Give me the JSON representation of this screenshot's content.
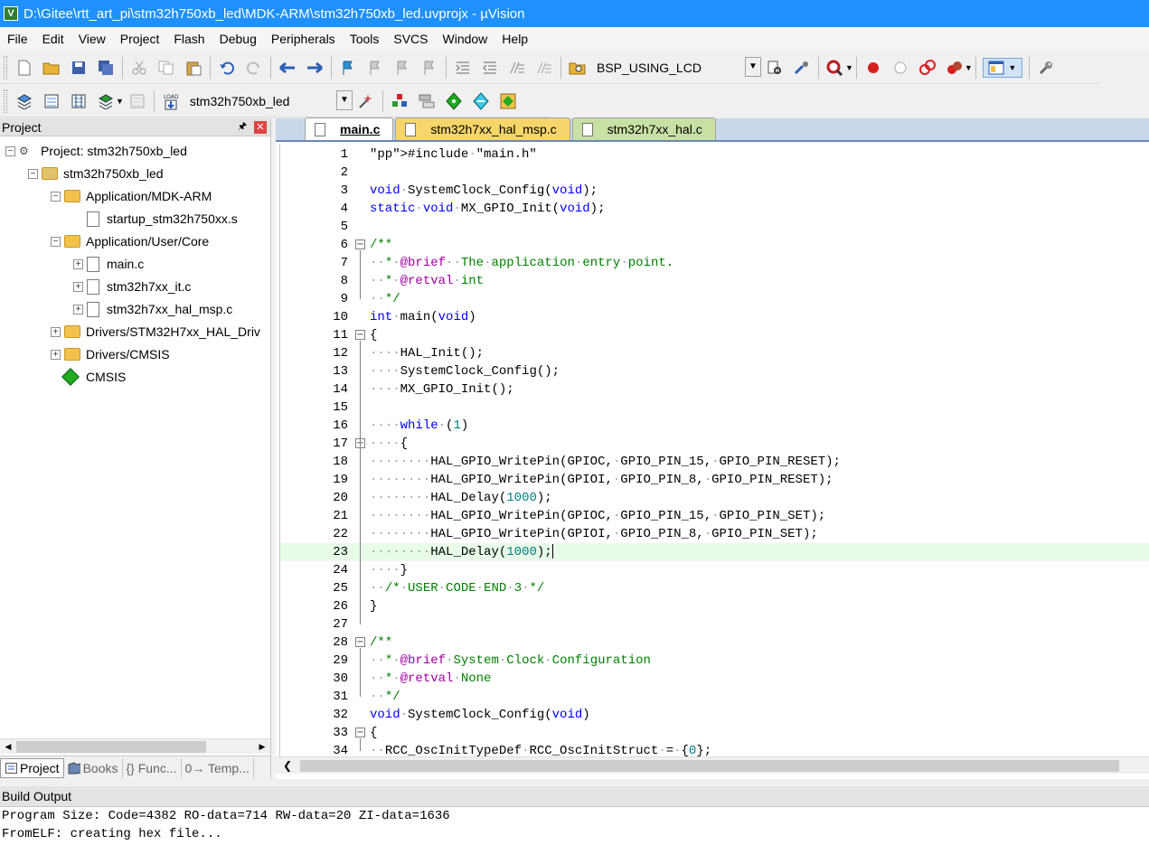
{
  "window": {
    "title": "D:\\Gitee\\rtt_art_pi\\stm32h750xb_led\\MDK-ARM\\stm32h750xb_led.uvprojx - µVision",
    "app_icon_letter": "V"
  },
  "menu": [
    "File",
    "Edit",
    "View",
    "Project",
    "Flash",
    "Debug",
    "Peripherals",
    "Tools",
    "SVCS",
    "Window",
    "Help"
  ],
  "toolbar": {
    "find_combo_value": "BSP_USING_LCD",
    "target_combo_value": "stm32h750xb_led"
  },
  "project_panel": {
    "title": "Project",
    "pin_glyph": "ᵖ",
    "close_glyph": "x",
    "tree": [
      {
        "label": "Project: stm32h750xb_led",
        "level": 0,
        "type": "project",
        "expander": "−"
      },
      {
        "label": "stm32h750xb_led",
        "level": 1,
        "type": "target",
        "expander": "−"
      },
      {
        "label": "Application/MDK-ARM",
        "level": 2,
        "type": "folder",
        "expander": "−"
      },
      {
        "label": "startup_stm32h750xx.s",
        "level": 3,
        "type": "file",
        "expander": ""
      },
      {
        "label": "Application/User/Core",
        "level": 2,
        "type": "folder",
        "expander": "−"
      },
      {
        "label": "main.c",
        "level": 3,
        "type": "file",
        "expander": "+"
      },
      {
        "label": "stm32h7xx_it.c",
        "level": 3,
        "type": "file",
        "expander": "+"
      },
      {
        "label": "stm32h7xx_hal_msp.c",
        "level": 3,
        "type": "file",
        "expander": "+"
      },
      {
        "label": "Drivers/STM32H7xx_HAL_Driv",
        "level": 2,
        "type": "folder",
        "expander": "+"
      },
      {
        "label": "Drivers/CMSIS",
        "level": 2,
        "type": "folder",
        "expander": "+"
      },
      {
        "label": "CMSIS",
        "level": 2,
        "type": "cmsis",
        "expander": ""
      }
    ],
    "tabs": [
      "Project",
      "Books",
      "{} Func...",
      "0→ Temp..."
    ]
  },
  "editor": {
    "tabs": [
      {
        "label": "main.c",
        "active": true
      },
      {
        "label": "stm32h7xx_hal_msp.c",
        "active": false
      },
      {
        "label": "stm32h7xx_hal.c",
        "active": false
      }
    ],
    "current_line": 23,
    "lines": [
      {
        "n": "1",
        "text": "#include·\"main.h\""
      },
      {
        "n": "2",
        "text": ""
      },
      {
        "n": "3",
        "text": "void·SystemClock_Config(void);"
      },
      {
        "n": "4",
        "text": "static·void·MX_GPIO_Init(void);"
      },
      {
        "n": "5",
        "text": ""
      },
      {
        "n": "6",
        "text": "/**",
        "fold": "−"
      },
      {
        "n": "7",
        "text": "··*·@brief··The·application·entry·point."
      },
      {
        "n": "8",
        "text": "··*·@retval·int"
      },
      {
        "n": "9",
        "text": "··*/"
      },
      {
        "n": "10",
        "text": "int·main(void)"
      },
      {
        "n": "11",
        "text": "{",
        "fold": "−"
      },
      {
        "n": "12",
        "text": "····HAL_Init();"
      },
      {
        "n": "13",
        "text": "····SystemClock_Config();"
      },
      {
        "n": "14",
        "text": "····MX_GPIO_Init();"
      },
      {
        "n": "15",
        "text": ""
      },
      {
        "n": "16",
        "text": "····while·(1)"
      },
      {
        "n": "17",
        "text": "····{",
        "fold": "−"
      },
      {
        "n": "18",
        "text": "········HAL_GPIO_WritePin(GPIOC,·GPIO_PIN_15,·GPIO_PIN_RESET);"
      },
      {
        "n": "19",
        "text": "········HAL_GPIO_WritePin(GPIOI,·GPIO_PIN_8,·GPIO_PIN_RESET);"
      },
      {
        "n": "20",
        "text": "········HAL_Delay(1000);"
      },
      {
        "n": "21",
        "text": "········HAL_GPIO_WritePin(GPIOC,·GPIO_PIN_15,·GPIO_PIN_SET);"
      },
      {
        "n": "22",
        "text": "········HAL_GPIO_WritePin(GPIOI,·GPIO_PIN_8,·GPIO_PIN_SET);"
      },
      {
        "n": "23",
        "text": "········HAL_Delay(1000);"
      },
      {
        "n": "24",
        "text": "····}"
      },
      {
        "n": "25",
        "text": "··/*·USER·CODE·END·3·*/"
      },
      {
        "n": "26",
        "text": "}"
      },
      {
        "n": "27",
        "text": ""
      },
      {
        "n": "28",
        "text": "/**",
        "fold": "−"
      },
      {
        "n": "29",
        "text": "··*·@brief·System·Clock·Configuration"
      },
      {
        "n": "30",
        "text": "··*·@retval·None"
      },
      {
        "n": "31",
        "text": "··*/"
      },
      {
        "n": "32",
        "text": "void·SystemClock_Config(void)"
      },
      {
        "n": "33",
        "text": "{",
        "fold": "−"
      },
      {
        "n": "34",
        "text": "··RCC_OscInitTypeDef·RCC_OscInitStruct·=·{0};"
      }
    ]
  },
  "build_output": {
    "title": "Build Output",
    "lines": [
      "Program Size: Code=4382 RO-data=714 RW-data=20 ZI-data=1636",
      "FromELF: creating hex file..."
    ]
  }
}
